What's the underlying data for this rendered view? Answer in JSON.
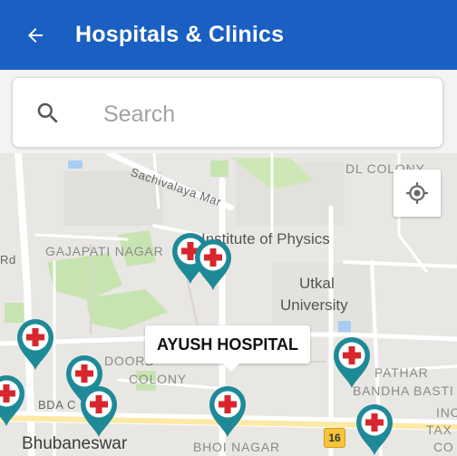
{
  "appbar": {
    "title": "Hospitals & Clinics",
    "back_icon": "arrow-left-icon",
    "background_color": "#1a5fc2"
  },
  "search": {
    "placeholder": "Search",
    "value": "",
    "icon": "search-icon"
  },
  "map": {
    "labels": {
      "sachivalaya_marg": "Sachivalaya Mar",
      "dl_colony": "DL COLONY",
      "gajapati_nagar": "GAJAPATI NAGAR",
      "rd": "Rd",
      "institute_of_physics": "Institute of Physics",
      "utkal_university_line1": "Utkal",
      "utkal_university_line2": "University",
      "doordarshan_colony_line1": "DOORD",
      "doordarshan_colony_line2": "COLONY",
      "bda_colony": "BDA C",
      "pathar_bandha_basti_line1": "PATHAR",
      "pathar_bandha_basti_line2": "BANDHA BASTI",
      "income_tax_colony_line1": "INC",
      "income_tax_colony_line2": "TAX C",
      "income_tax_colony_line3": "CO",
      "bhubaneswar": "Bhubaneswar",
      "bhoi_nagar": "BHOI NAGAR"
    },
    "highway_shield": "16",
    "callout_label": "AYUSH HOSPITAL",
    "locate_icon": "my-location-icon",
    "marker_icon": "hospital-cross-icon",
    "marker_color": "#1e8a98",
    "cross_color": "#d7262c",
    "marker_count": 10
  }
}
